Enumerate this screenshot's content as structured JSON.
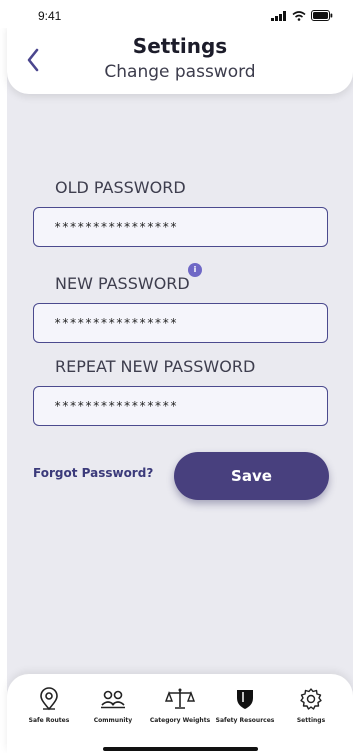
{
  "status_bar": {
    "time": "9:41"
  },
  "header": {
    "title": "Settings",
    "subtitle": "Change password"
  },
  "form": {
    "old_password_label": "OLD PASSWORD",
    "old_password_value": "****************",
    "new_password_label": "NEW PASSWORD",
    "new_password_value": "****************",
    "repeat_password_label": "REPEAT NEW PASSWORD",
    "repeat_password_value": "****************",
    "info_glyph": "i"
  },
  "actions": {
    "forgot_label": "Forgot Password?",
    "save_label": "Save"
  },
  "tabs": [
    {
      "label": "Safe Routes",
      "icon": "map-pin-icon"
    },
    {
      "label": "Community",
      "icon": "people-icon"
    },
    {
      "label": "Category Weights",
      "icon": "scale-icon"
    },
    {
      "label": "Safety Resources",
      "icon": "shield-icon"
    },
    {
      "label": "Settings",
      "icon": "gear-icon"
    }
  ],
  "colors": {
    "accent": "#48407e",
    "background": "#eaeaf0",
    "info": "#6f68c6"
  }
}
